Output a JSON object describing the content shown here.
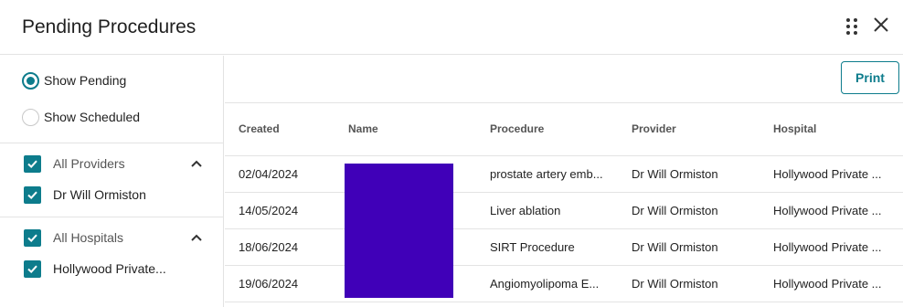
{
  "header": {
    "title": "Pending Procedures"
  },
  "filters": {
    "show_pending": "Show Pending",
    "show_scheduled": "Show Scheduled",
    "selected": "Show Pending"
  },
  "providers": {
    "all_label": "All Providers",
    "items": [
      {
        "label": "Dr Will Ormiston",
        "checked": true
      }
    ],
    "all_checked": true
  },
  "hospitals": {
    "all_label": "All Hospitals",
    "items": [
      {
        "label": "Hollywood Private...",
        "checked": true
      }
    ],
    "all_checked": true
  },
  "toolbar": {
    "print_label": "Print"
  },
  "table": {
    "columns": [
      "Created",
      "Name",
      "Procedure",
      "Provider",
      "Hospital"
    ],
    "rows": [
      {
        "created": "02/04/2024",
        "name": "",
        "procedure": "prostate artery emb...",
        "provider": "Dr Will Ormiston",
        "hospital": "Hollywood Private ..."
      },
      {
        "created": "14/05/2024",
        "name": "",
        "procedure": "Liver ablation",
        "provider": "Dr Will Ormiston",
        "hospital": "Hollywood Private ..."
      },
      {
        "created": "18/06/2024",
        "name": "",
        "procedure": "SIRT Procedure",
        "provider": "Dr Will Ormiston",
        "hospital": "Hollywood Private ..."
      },
      {
        "created": "19/06/2024",
        "name": "",
        "procedure": "Angiomyolipoma E...",
        "provider": "Dr Will Ormiston",
        "hospital": "Hollywood Private ..."
      }
    ]
  },
  "colors": {
    "accent": "#0d7c8c",
    "redaction": "#4000b8"
  },
  "icons": {
    "drag": "drag-handle-icon",
    "close": "close-icon",
    "collapse": "chevron-up-icon",
    "check": "checkmark-icon"
  }
}
